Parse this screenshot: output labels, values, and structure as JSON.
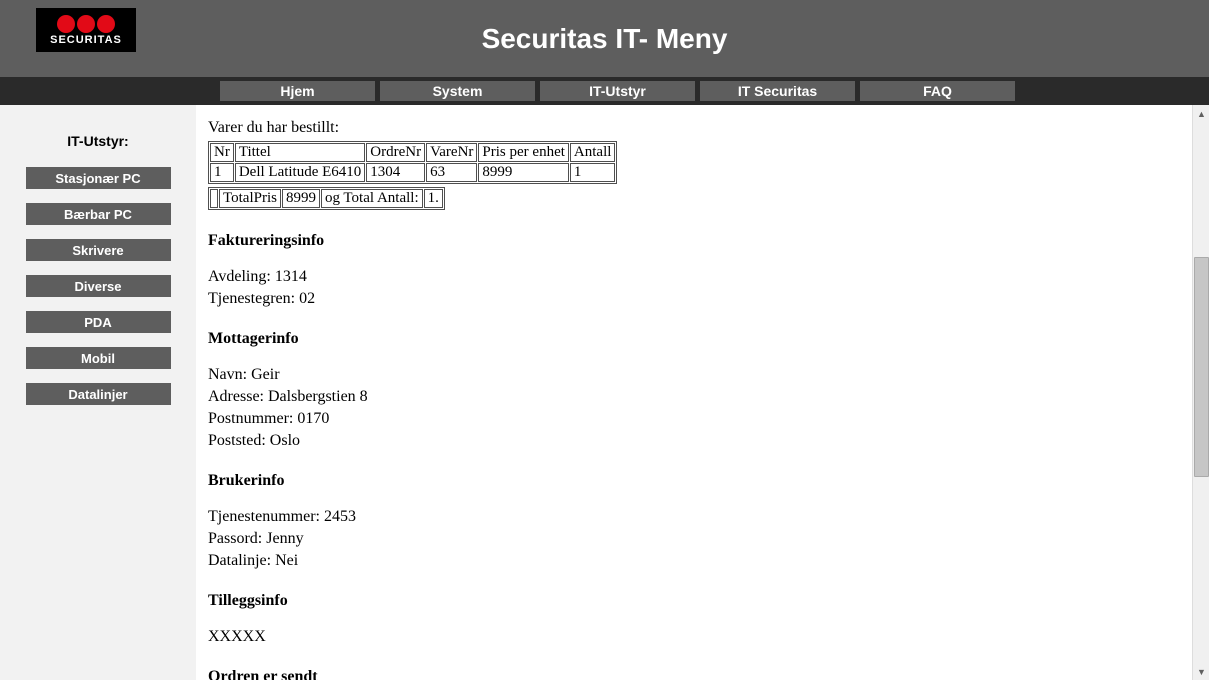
{
  "header": {
    "logo_text": "SECURITAS",
    "app_title": "Securitas IT- Meny"
  },
  "nav": [
    "Hjem",
    "System",
    "IT-Utstyr",
    "IT Securitas",
    "FAQ"
  ],
  "sidebar": {
    "title": "IT-Utstyr:",
    "items": [
      "Stasjonær PC",
      "Bærbar PC",
      "Skrivere",
      "Diverse",
      "PDA",
      "Mobil",
      "Datalinjer"
    ]
  },
  "main": {
    "order_heading": "Varer du har bestillt:",
    "table_headers": [
      "Nr",
      "Tittel",
      "OrdreNr",
      "VareNr",
      "Pris per enhet",
      "Antall"
    ],
    "table_rows": [
      [
        "1",
        "Dell Latitude E6410",
        "1304",
        "63",
        "8999",
        "1"
      ]
    ],
    "totals": {
      "c0": "",
      "c1_label": "TotalPris",
      "c1_value": "8999",
      "c2_label": "og Total Antall:",
      "c2_value": "1."
    },
    "sections": {
      "faktureringsinfo": {
        "title": "Faktureringsinfo",
        "avdeling_label": "Avdeling:",
        "avdeling_value": "1314",
        "tjenestegren_label": "Tjenestegren:",
        "tjenestegren_value": "02"
      },
      "mottagerinfo": {
        "title": "Mottagerinfo",
        "navn_label": "Navn:",
        "navn_value": "Geir",
        "adresse_label": "Adresse:",
        "adresse_value": "Dalsbergstien 8",
        "postnummer_label": "Postnummer:",
        "postnummer_value": "0170",
        "poststed_label": "Poststed:",
        "poststed_value": "Oslo"
      },
      "brukerinfo": {
        "title": "Brukerinfo",
        "tjenestenummer_label": "Tjenestenummer:",
        "tjenestenummer_value": "2453",
        "passord_label": "Passord:",
        "passord_value": "Jenny",
        "datalinje_label": "Datalinje:",
        "datalinje_value": "Nei"
      },
      "tilleggsinfo": {
        "title": "Tilleggsinfo",
        "value": "XXXXX"
      },
      "ordren": {
        "title": "Ordren er sendt"
      }
    }
  }
}
